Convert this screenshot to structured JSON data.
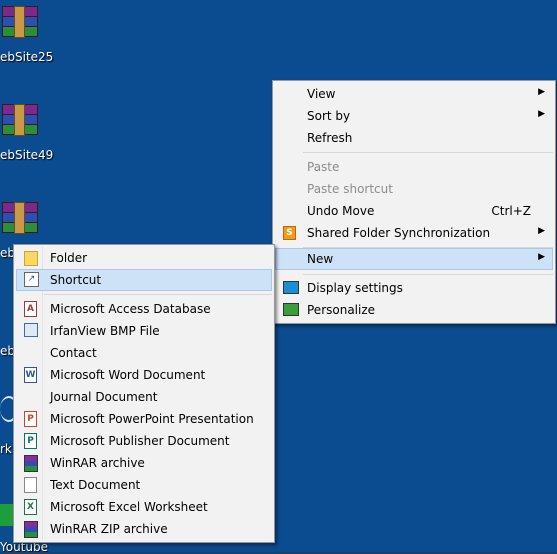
{
  "desktop": {
    "icons": [
      {
        "label": "ebSite25"
      },
      {
        "label": "ebSite49"
      },
      {
        "label": "eb"
      },
      {
        "label": "eb"
      },
      {
        "label": "rki"
      },
      {
        "label": "Youtube"
      }
    ]
  },
  "context_menu": {
    "items": [
      {
        "label": "View"
      },
      {
        "label": "Sort by"
      },
      {
        "label": "Refresh"
      },
      {
        "label": "Paste"
      },
      {
        "label": "Paste shortcut"
      },
      {
        "label": "Undo Move",
        "shortcut": "Ctrl+Z"
      },
      {
        "label": "Shared Folder Synchronization"
      },
      {
        "label": "New"
      },
      {
        "label": "Display settings"
      },
      {
        "label": "Personalize"
      }
    ]
  },
  "new_submenu": {
    "items": [
      {
        "label": "Folder"
      },
      {
        "label": "Shortcut"
      },
      {
        "label": "Microsoft Access Database"
      },
      {
        "label": "IrfanView BMP File"
      },
      {
        "label": "Contact"
      },
      {
        "label": "Microsoft Word Document"
      },
      {
        "label": "Journal Document"
      },
      {
        "label": "Microsoft PowerPoint Presentation"
      },
      {
        "label": "Microsoft Publisher Document"
      },
      {
        "label": "WinRAR archive"
      },
      {
        "label": "Text Document"
      },
      {
        "label": "Microsoft Excel Worksheet"
      },
      {
        "label": "WinRAR ZIP archive"
      }
    ]
  },
  "colors": {
    "desktop_bg": "#0b4b8f",
    "highlight": "#cde1f7"
  }
}
